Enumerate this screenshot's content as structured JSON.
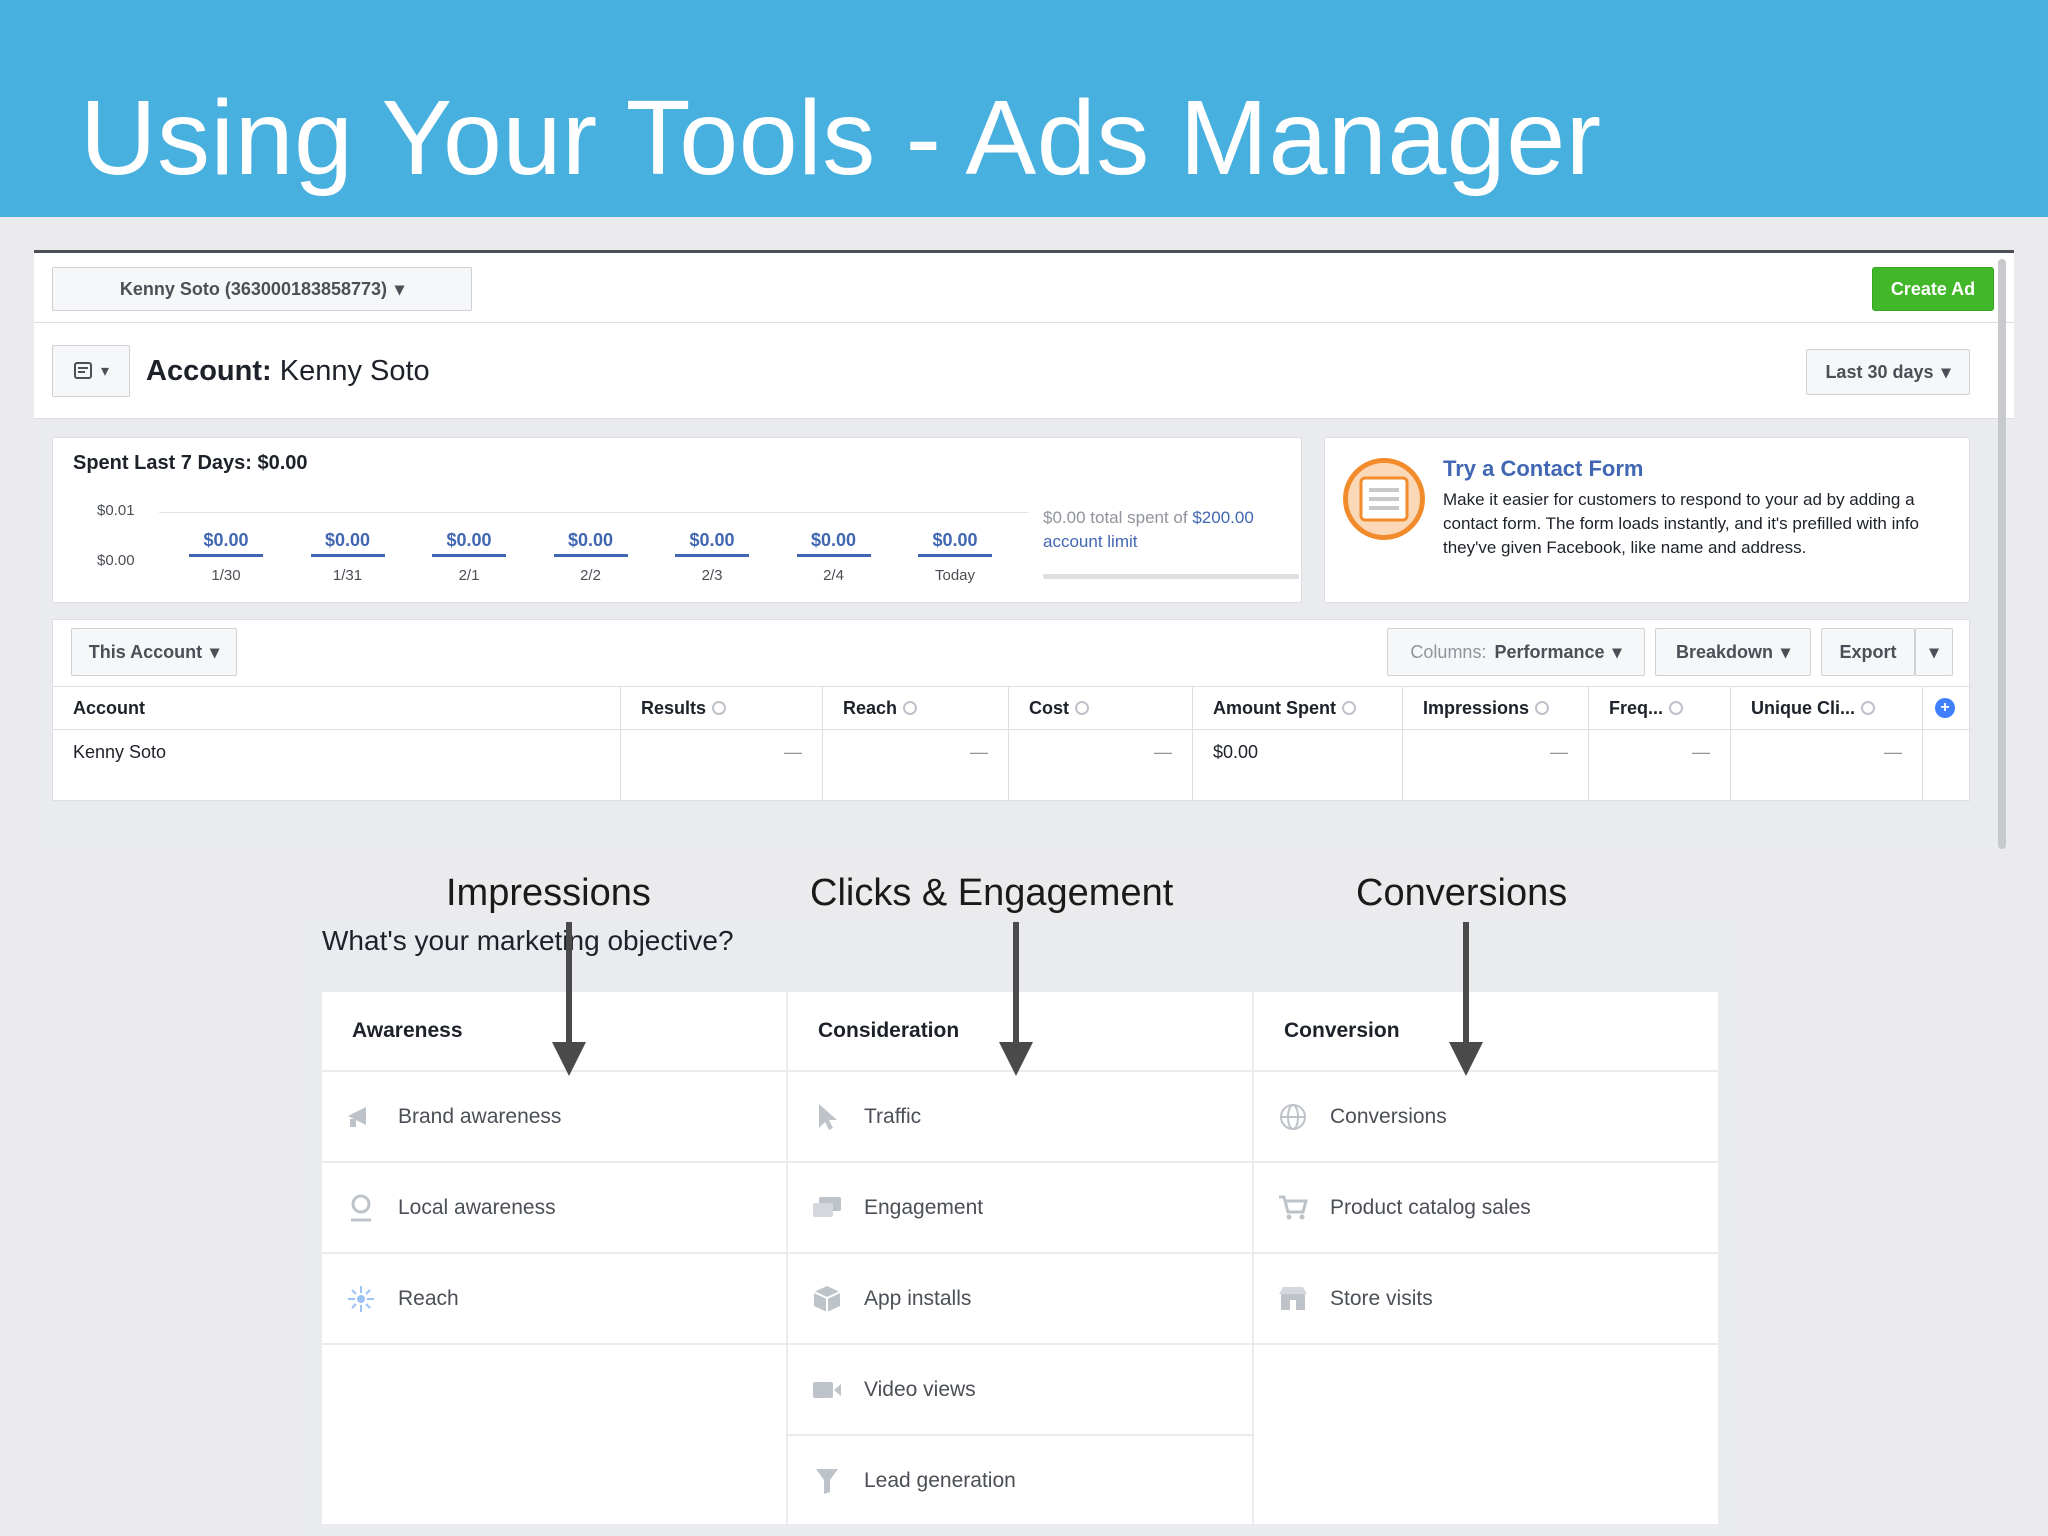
{
  "slide": {
    "title": "Using Your Tools - Ads Manager"
  },
  "ads_manager": {
    "account_selector": "Kenny Soto (363000183858773)",
    "create_ad": "Create Ad",
    "account_label": "Account:",
    "account_name": "Kenny Soto",
    "date_range": "Last 30 days",
    "spend": {
      "title": "Spent Last 7 Days: $0.00",
      "yticks": [
        "$0.01",
        "$0.00"
      ],
      "days": [
        {
          "value": "$0.00",
          "date": "1/30"
        },
        {
          "value": "$0.00",
          "date": "1/31"
        },
        {
          "value": "$0.00",
          "date": "2/1"
        },
        {
          "value": "$0.00",
          "date": "2/2"
        },
        {
          "value": "$0.00",
          "date": "2/3"
        },
        {
          "value": "$0.00",
          "date": "2/4"
        },
        {
          "value": "$0.00",
          "date": "Today"
        }
      ],
      "limit_prefix": "$0.00 total spent of",
      "limit_amount": "$200.00",
      "limit_suffix": "account limit"
    },
    "promo": {
      "title": "Try a Contact Form",
      "body": "Make it easier for customers to respond to your ad by adding a contact form. The form loads instantly, and it's prefilled with info they've given Facebook, like name and address."
    },
    "toolbar": {
      "scope": "This Account",
      "columns_label": "Columns:",
      "columns_value": "Performance",
      "breakdown": "Breakdown",
      "export": "Export"
    },
    "table": {
      "headers": [
        "Account",
        "Results",
        "Reach",
        "Cost",
        "Amount Spent",
        "Impressions",
        "Freq...",
        "Unique Cli..."
      ],
      "row": [
        "Kenny Soto",
        "—",
        "—",
        "—",
        "$0.00",
        "—",
        "—",
        "—"
      ]
    }
  },
  "annotations": {
    "impressions": "Impressions",
    "clicks": "Clicks & Engagement",
    "conversions": "Conversions"
  },
  "objectives": {
    "question": "What's your marketing objective?",
    "columns": [
      {
        "heading": "Awareness",
        "items": [
          {
            "label": "Brand awareness",
            "icon": "megaphone-icon"
          },
          {
            "label": "Local awareness",
            "icon": "map-pin-icon"
          },
          {
            "label": "Reach",
            "icon": "reach-icon"
          }
        ]
      },
      {
        "heading": "Consideration",
        "items": [
          {
            "label": "Traffic",
            "icon": "cursor-icon"
          },
          {
            "label": "Engagement",
            "icon": "chat-bubbles-icon"
          },
          {
            "label": "App installs",
            "icon": "box-icon"
          },
          {
            "label": "Video views",
            "icon": "video-camera-icon"
          },
          {
            "label": "Lead generation",
            "icon": "funnel-icon"
          }
        ]
      },
      {
        "heading": "Conversion",
        "items": [
          {
            "label": "Conversions",
            "icon": "globe-icon"
          },
          {
            "label": "Product catalog sales",
            "icon": "cart-icon"
          },
          {
            "label": "Store visits",
            "icon": "store-icon"
          }
        ]
      }
    ]
  }
}
